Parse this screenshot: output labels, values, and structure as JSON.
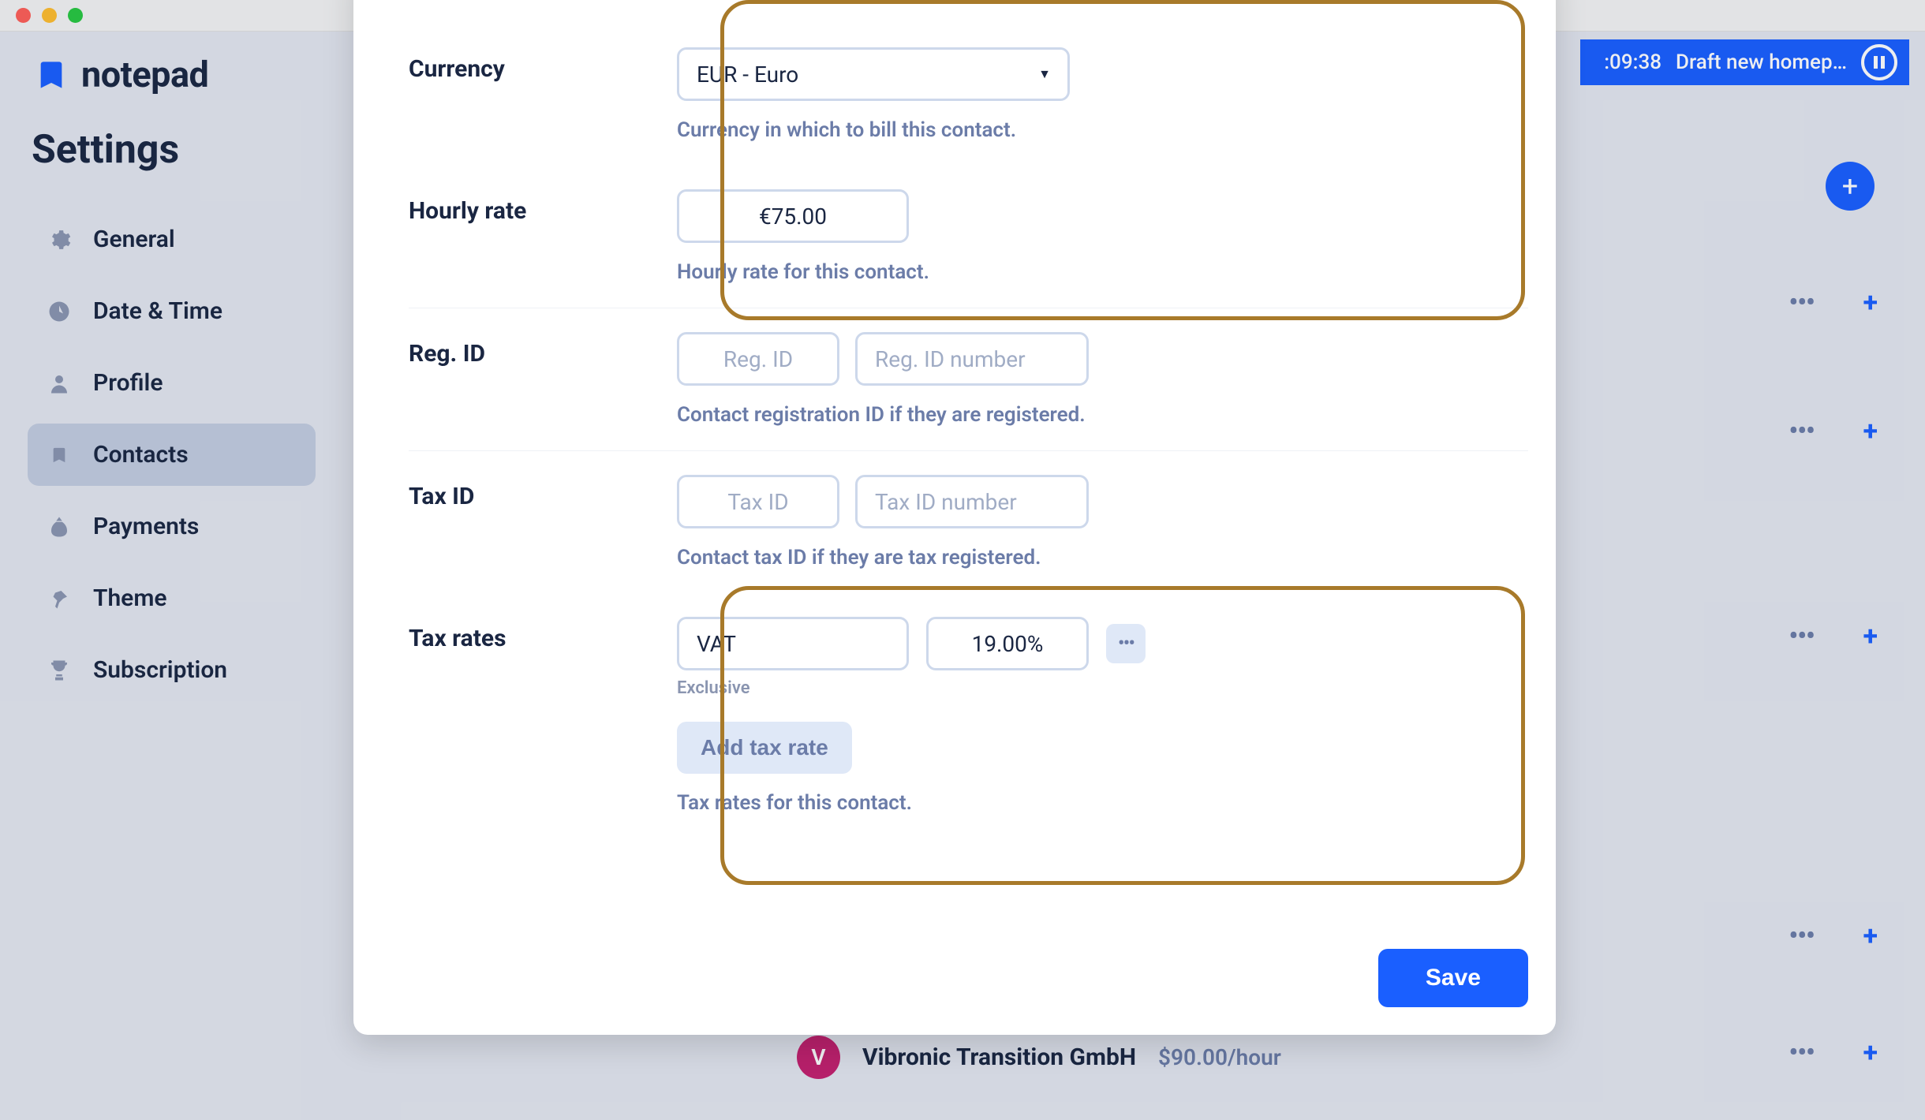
{
  "app": {
    "name": "notepad"
  },
  "page_title": "Settings",
  "sidebar": {
    "items": [
      {
        "label": "General",
        "icon": "gear-icon"
      },
      {
        "label": "Date & Time",
        "icon": "clock-icon"
      },
      {
        "label": "Profile",
        "icon": "user-icon"
      },
      {
        "label": "Contacts",
        "icon": "bookmark-icon"
      },
      {
        "label": "Payments",
        "icon": "moneybag-icon"
      },
      {
        "label": "Theme",
        "icon": "pin-icon"
      },
      {
        "label": "Subscription",
        "icon": "trophy-icon"
      }
    ]
  },
  "banner": {
    "time": ":09:38",
    "task": "Draft new homep…"
  },
  "bg_item": {
    "initial": "V",
    "name": "Vibronic Transition GmbH",
    "rate": "$90.00/hour"
  },
  "modal": {
    "currency": {
      "label": "Currency",
      "value": "EUR - Euro",
      "help": "Currency in which to bill this contact."
    },
    "hourly": {
      "label": "Hourly rate",
      "value": "€75.00",
      "help": "Hourly rate for this contact."
    },
    "reg_id": {
      "label": "Reg. ID",
      "placeholder_label": "Reg. ID",
      "placeholder_number": "Reg. ID number",
      "help": "Contact registration ID if they are registered."
    },
    "tax_id": {
      "label": "Tax ID",
      "placeholder_label": "Tax ID",
      "placeholder_number": "Tax ID number",
      "help": "Contact tax ID if they are tax registered."
    },
    "tax_rates": {
      "label": "Tax rates",
      "name_value": "VAT",
      "rate_value": "19.00%",
      "subhelp": "Exclusive",
      "add_button": "Add tax rate",
      "help": "Tax rates for this contact."
    },
    "save_button": "Save"
  }
}
